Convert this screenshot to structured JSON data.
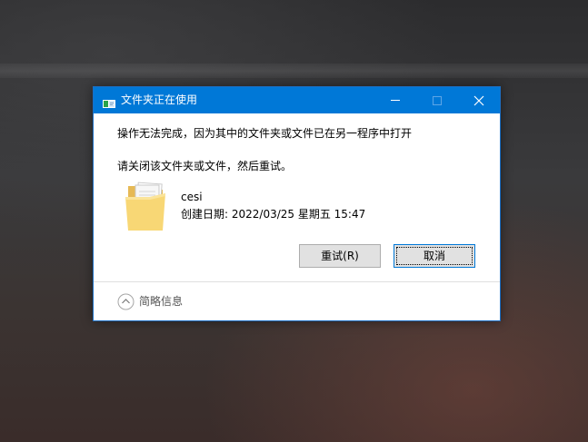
{
  "window": {
    "title": "文件夹正在使用",
    "icons": {
      "app": "folder-in-use-icon",
      "minimize": "minimize-icon",
      "maximize": "maximize-icon",
      "close": "close-icon"
    }
  },
  "message": {
    "line1": "操作无法完成，因为其中的文件夹或文件已在另一程序中打开",
    "line2": "请关闭该文件夹或文件，然后重试。"
  },
  "file": {
    "icon": "folder-icon",
    "name": "cesi",
    "date_label": "创建日期: 2022/03/25 星期五 15:47"
  },
  "buttons": {
    "retry": "重试(R)",
    "cancel": "取消"
  },
  "details": {
    "icon": "chevron-up-icon",
    "label": "简略信息"
  },
  "colors": {
    "titlebar": "#0078d7",
    "button_face": "#e1e1e1",
    "focus_border": "#0078d7"
  }
}
